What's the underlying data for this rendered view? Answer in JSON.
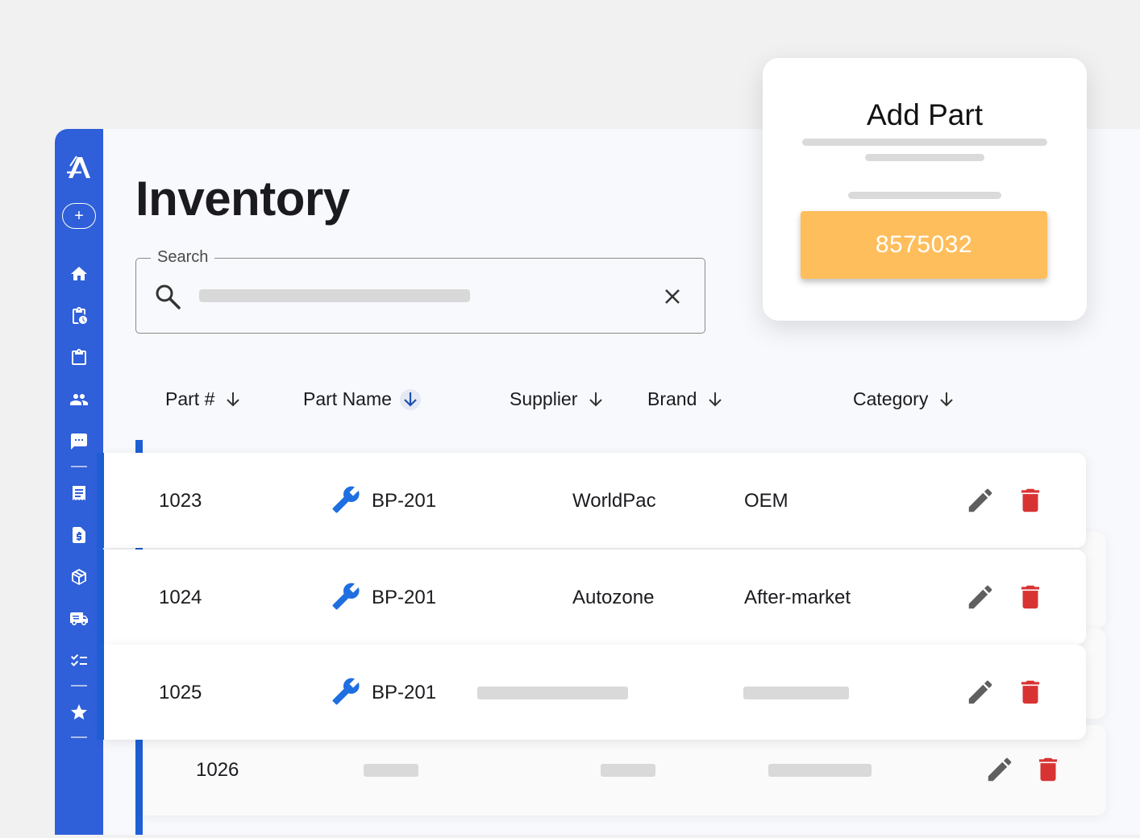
{
  "page": {
    "title": "Inventory"
  },
  "search": {
    "label": "Search",
    "value": ""
  },
  "sidebar": {
    "add_icon": "plus-circle-icon",
    "items": [
      {
        "icon": "home-icon"
      },
      {
        "icon": "clipboard-clock-icon"
      },
      {
        "icon": "clipboard-icon"
      },
      {
        "icon": "people-icon"
      },
      {
        "icon": "chat-icon"
      },
      {
        "icon": "receipt-icon"
      },
      {
        "icon": "invoice-dollar-icon"
      },
      {
        "icon": "package-icon"
      },
      {
        "icon": "delivery-truck-icon"
      },
      {
        "icon": "checklist-icon"
      },
      {
        "icon": "star-icon"
      }
    ]
  },
  "table": {
    "columns": [
      {
        "label": "Part #"
      },
      {
        "label": "Part Name"
      },
      {
        "label": "Supplier"
      },
      {
        "label": "Brand"
      },
      {
        "label": "Category"
      }
    ],
    "sorted_column": "Part Name",
    "rows": [
      {
        "part_no": "1023",
        "part_name": "BP-201",
        "supplier": "WorldPac",
        "brand": "OEM"
      },
      {
        "part_no": "1024",
        "part_name": "BP-201",
        "supplier": "Autozone",
        "brand": "After-market"
      },
      {
        "part_no": "1025",
        "part_name": "BP-201",
        "supplier": "",
        "brand": ""
      },
      {
        "part_no": "1026",
        "part_name": "",
        "supplier": "",
        "brand": ""
      }
    ]
  },
  "modal": {
    "title": "Add Part",
    "button_label": "8575032"
  },
  "colors": {
    "sidebar": "#2f5fd9",
    "accent": "#1f5fd6",
    "modal_button": "#ffbe5c",
    "delete": "#d83333",
    "edit": "#5f5f5f",
    "wrench": "#1f6fe0"
  }
}
